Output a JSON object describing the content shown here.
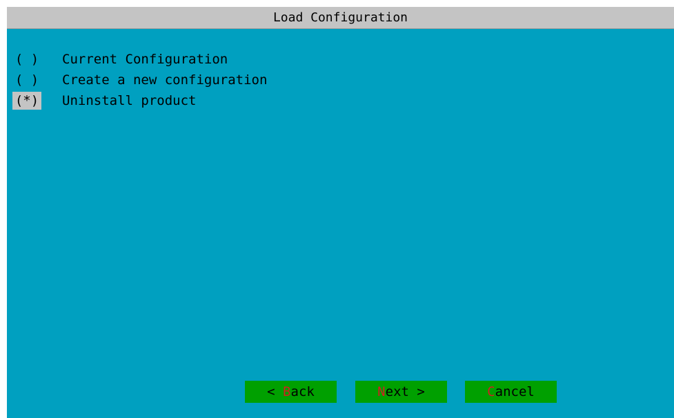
{
  "dialog": {
    "title": "Load Configuration"
  },
  "options": [
    {
      "marker": "( )",
      "label": "Current Configuration",
      "selected": false
    },
    {
      "marker": "( )",
      "label": "Create a new configuration",
      "selected": false
    },
    {
      "marker": "(*)",
      "label": "Uninstall product",
      "selected": true
    }
  ],
  "buttons": {
    "back": {
      "prefix": "< ",
      "hotkey": "B",
      "rest": "ack"
    },
    "next": {
      "prefix": "",
      "hotkey": "N",
      "rest": "ext >"
    },
    "cancel": {
      "prefix": "",
      "hotkey": "C",
      "rest": "ancel"
    }
  },
  "colors": {
    "background": "#00a0c0",
    "title_bar": "#c4c4c4",
    "button": "#00a000",
    "hotkey": "#d02020",
    "selection_highlight": "#c4c4c4"
  }
}
